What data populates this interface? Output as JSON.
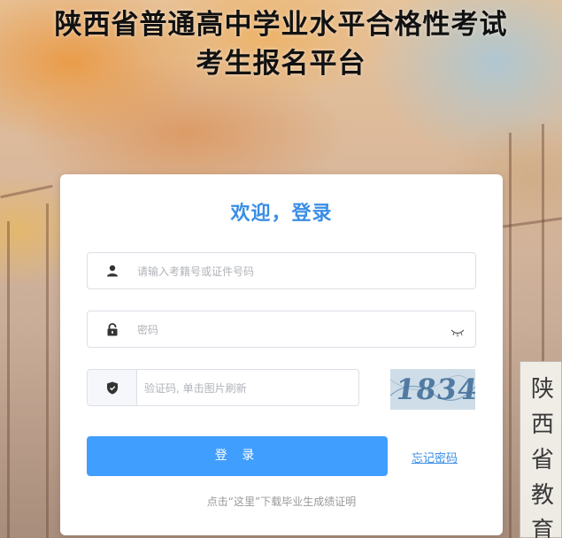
{
  "page": {
    "title_line1": "陕西省普通高中学业水平合格性考试",
    "title_line2": "考生报名平台"
  },
  "login": {
    "welcome": "欢迎，登录",
    "account_placeholder": "请输入考籍号或证件号码",
    "password_placeholder": "密码",
    "captcha_placeholder": "验证码, 单击图片刷新",
    "captcha_image_text": "1834",
    "login_button": "登 录",
    "forgot_password": "忘记密码",
    "footer_note": "点击“这里”下载毕业生成绩证明"
  },
  "colors": {
    "accent": "#409eff",
    "welcome_text": "#3a8ee6"
  },
  "icons": [
    "user-icon",
    "lock-icon",
    "eye-closed-icon",
    "shield-icon"
  ]
}
